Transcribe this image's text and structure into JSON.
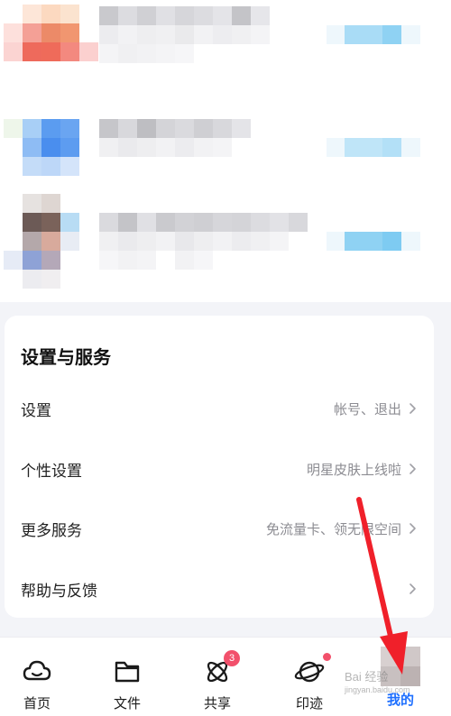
{
  "section": {
    "title": "设置与服务"
  },
  "settings": [
    {
      "label": "设置",
      "value": "帐号、退出"
    },
    {
      "label": "个性设置",
      "value": "明星皮肤上线啦"
    },
    {
      "label": "更多服务",
      "value": "免流量卡、领无限空间"
    },
    {
      "label": "帮助与反馈",
      "value": ""
    }
  ],
  "tabs": [
    {
      "label": "首页",
      "icon": "cloud-home-icon"
    },
    {
      "label": "文件",
      "icon": "folder-icon"
    },
    {
      "label": "共享",
      "icon": "share-atom-icon",
      "badge": "3"
    },
    {
      "label": "印迹",
      "icon": "planet-icon"
    },
    {
      "label": "我的",
      "icon": "avatar-icon"
    }
  ],
  "watermark": {
    "line1": "Bai 经验",
    "line2": "jingyan.baidu.com"
  },
  "colors": {
    "accent": "#1e6fff",
    "badge": "#f2506b",
    "annotation_arrow": "#f0202a"
  }
}
